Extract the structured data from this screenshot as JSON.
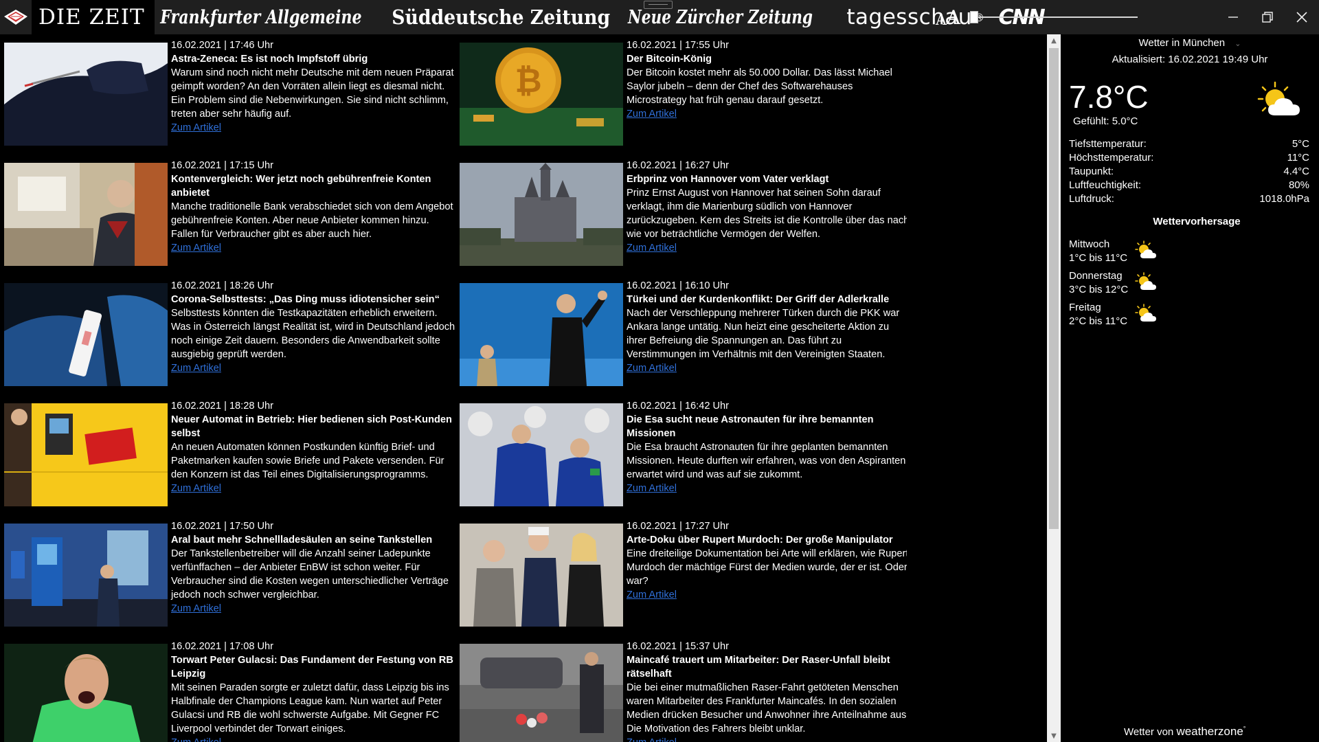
{
  "tabs": [
    {
      "id": "zeit",
      "label": "DIE ZEIT"
    },
    {
      "id": "faz",
      "label": "Frankfurter Allgemeine"
    },
    {
      "id": "sz",
      "label": "Süddeutsche Zeitung"
    },
    {
      "id": "nzz",
      "label": "Neue Zürcher Zeitung"
    },
    {
      "id": "tagesschau",
      "label": "tagesschau"
    },
    {
      "id": "cnn",
      "label": "CNN"
    }
  ],
  "font_size_control": {
    "small": "A",
    "large": "A",
    "level": 0.0
  },
  "articles_left": [
    {
      "date": "16.02.2021 | 17:46 Uhr",
      "headline": "Astra-Zeneca: Es ist noch Impfstoff übrig",
      "description": "Warum sind noch nicht mehr Deutsche mit dem neuen Präparat geimpft worden? An den Vorräten allein liegt es diesmal nicht. Ein Problem sind die Nebenwirkungen. Sie sind nicht schlimm, treten aber sehr häufig auf.",
      "link": "Zum Artikel"
    },
    {
      "date": "16.02.2021 | 17:15 Uhr",
      "headline": "Kontenvergleich: Wer jetzt noch gebührenfreie Konten anbietet",
      "description": "Manche traditionelle Bank verabschiedet sich von dem Angebot gebührenfreie Konten. Aber neue Anbieter kommen hinzu. Fallen für Verbraucher gibt es aber auch hier.",
      "link": "Zum Artikel"
    },
    {
      "date": "16.02.2021 | 18:26 Uhr",
      "headline": "Corona-Selbsttests: „Das Ding muss idiotensicher sein“",
      "description": "Selbsttests könnten die Testkapazitäten erheblich erweitern. Was in Österreich längst Realität ist, wird in Deutschland jedoch noch einige Zeit dauern. Besonders die Anwendbarkeit sollte ausgiebig geprüft werden.",
      "link": "Zum Artikel"
    },
    {
      "date": "16.02.2021 | 18:28 Uhr",
      "headline": "Neuer Automat in Betrieb: Hier bedienen sich Post-Kunden selbst",
      "description": "An neuen Automaten können Postkunden künftig Brief- und Paketmarken kaufen sowie Briefe und Pakete versenden. Für den Konzern ist das Teil eines Digitalisierungsprogramms.",
      "link": "Zum Artikel"
    },
    {
      "date": "16.02.2021 | 17:50 Uhr",
      "headline": "Aral baut mehr Schnellladesäulen an seine Tankstellen",
      "description": "Der Tankstellenbetreiber will die Anzahl seiner Ladepunkte verfünffachen – der Anbieter EnBW ist schon weiter. Für Verbraucher sind die Kosten wegen unterschiedlicher Verträge jedoch noch schwer vergleichbar.",
      "link": "Zum Artikel"
    },
    {
      "date": "16.02.2021 | 17:08 Uhr",
      "headline": "Torwart Peter Gulacsi: Das Fundament der Festung von RB Leipzig",
      "description": "Mit seinen Paraden sorgte er zuletzt dafür, dass Leipzig bis ins Halbfinale der Champions League kam. Nun wartet auf Peter Gulacsi und RB die wohl schwerste Aufgabe. Mit Gegner FC Liverpool verbindet der Torwart einiges.",
      "link": "Zum Artikel"
    }
  ],
  "articles_right": [
    {
      "date": "16.02.2021 | 17:55 Uhr",
      "headline": "Der Bitcoin-König",
      "description": "Der Bitcoin kostet mehr als 50.000 Dollar. Das lässt Michael Saylor jubeln – denn der Chef des Softwarehauses Microstrategy hat früh genau darauf gesetzt.",
      "link": "Zum Artikel"
    },
    {
      "date": "16.02.2021 | 16:27 Uhr",
      "headline": "Erbprinz von Hannover vom Vater verklagt",
      "description": "Prinz Ernst August von Hannover hat seinen Sohn darauf verklagt, ihm die Marienburg südlich von Hannover zurückzugeben. Kern des Streits ist die Kontrolle über das nach wie vor beträchtliche Vermögen der Welfen.",
      "link": "Zum Artikel"
    },
    {
      "date": "16.02.2021 | 16:10 Uhr",
      "headline": "Türkei und der Kurdenkonflikt: Der Griff der Adlerkralle",
      "description": "Nach der Verschleppung mehrerer Türken durch die PKK war Ankara lange untätig. Nun heizt eine gescheiterte Aktion zu ihrer Befreiung die Spannungen an. Das führt zu Verstimmungen im Verhältnis mit den Vereinigten Staaten.",
      "link": "Zum Artikel"
    },
    {
      "date": "16.02.2021 | 16:42 Uhr",
      "headline": "Die Esa sucht neue Astronauten für ihre bemannten Missionen",
      "description": "Die Esa braucht Astronauten für ihre geplanten bemannten Missionen. Heute durften wir erfahren, was von den Aspiranten erwartet wird und was auf sie zukommt.",
      "link": "Zum Artikel"
    },
    {
      "date": "16.02.2021 | 17:27 Uhr",
      "headline": "Arte-Doku über Rupert Murdoch: Der große Manipulator",
      "description": "Eine dreiteilige Dokumentation bei Arte will erklären, wie Rupert Murdoch der mächtige Fürst der Medien wurde, der er ist. Oder war?",
      "link": "Zum Artikel"
    },
    {
      "date": "16.02.2021 | 15:37 Uhr",
      "headline": "Maincafé trauert um Mitarbeiter: Der Raser-Unfall bleibt rätselhaft",
      "description": "Die bei einer mutmaßlichen Raser-Fahrt getöteten Menschen waren Mitarbeiter des Frankfurter Maincafés. In den sozialen Medien drücken  Besucher und Anwohner ihre Anteilnahme aus. Die Motivation des Fahrers bleibt unklar.",
      "link": "Zum Artikel"
    }
  ],
  "weather": {
    "location_prefix": "Wetter in",
    "location": "München",
    "updated": "Aktualisiert: 16.02.2021 19:49 Uhr",
    "temperature": "7.8°C",
    "feels_like": "Gefühlt: 5.0°C",
    "condition_icon": "partly-sunny-icon",
    "stats": [
      {
        "label": "Tiefsttemperatur:",
        "value": "5°C"
      },
      {
        "label": "Höchsttemperatur:",
        "value": "11°C"
      },
      {
        "label": "Taupunkt:",
        "value": "4.4°C"
      },
      {
        "label": "Luftfeuchtigkeit:",
        "value": "80%"
      },
      {
        "label": "Luftdruck:",
        "value": "1018.0hPa"
      }
    ],
    "forecast_title": "Wettervorhersage",
    "forecast": [
      {
        "day": "Mittwoch",
        "range": "1°C bis 11°C",
        "icon": "partly-sunny-icon"
      },
      {
        "day": "Donnerstag",
        "range": "3°C bis 12°C",
        "icon": "partly-sunny-icon"
      },
      {
        "day": "Freitag",
        "range": "2°C bis 11°C",
        "icon": "partly-sunny-icon"
      }
    ],
    "footer_prefix": "Wetter von",
    "footer_brand": "weatherzone"
  },
  "colors": {
    "background": "#000000",
    "topbar": "#1f1f1f",
    "link": "#2f6fd8",
    "sun": "#f5c518"
  }
}
